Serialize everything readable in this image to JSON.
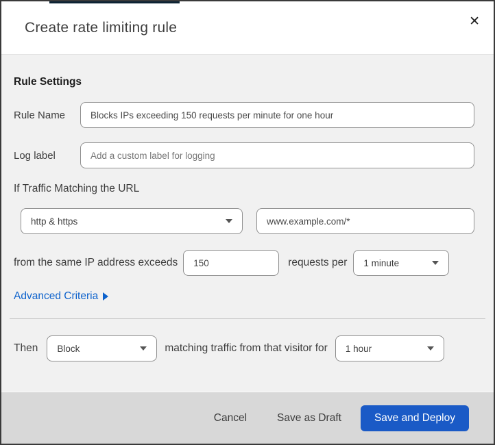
{
  "dialog": {
    "title": "Create rate limiting rule",
    "close_icon": "✕"
  },
  "rule_settings": {
    "heading": "Rule Settings",
    "rule_name": {
      "label": "Rule Name",
      "value": "Blocks IPs exceeding 150 requests per minute for one hour"
    },
    "log_label": {
      "label": "Log label",
      "placeholder": "Add a custom label for logging"
    }
  },
  "traffic_match": {
    "heading": "If Traffic Matching the URL",
    "protocol_select": {
      "value": "http & https"
    },
    "url_input": {
      "value": "www.example.com/*"
    },
    "threshold": {
      "prefix": "from the same IP address exceeds",
      "requests_value": "150",
      "middle": "requests per",
      "period_select": {
        "value": "1 minute"
      }
    },
    "advanced_criteria": {
      "label": "Advanced Criteria"
    }
  },
  "action": {
    "prefix": "Then",
    "action_select": {
      "value": "Block"
    },
    "middle": "matching traffic from that visitor for",
    "duration_select": {
      "value": "1 hour"
    }
  },
  "footer": {
    "cancel_label": "Cancel",
    "save_draft_label": "Save as Draft",
    "save_deploy_label": "Save and Deploy"
  },
  "colors": {
    "primary_button": "#1a5ac6",
    "link_blue": "#0d62cc",
    "body_bg": "#f1f1f1",
    "footer_bg": "#d8d8d8",
    "top_strip": "#0d2334"
  }
}
